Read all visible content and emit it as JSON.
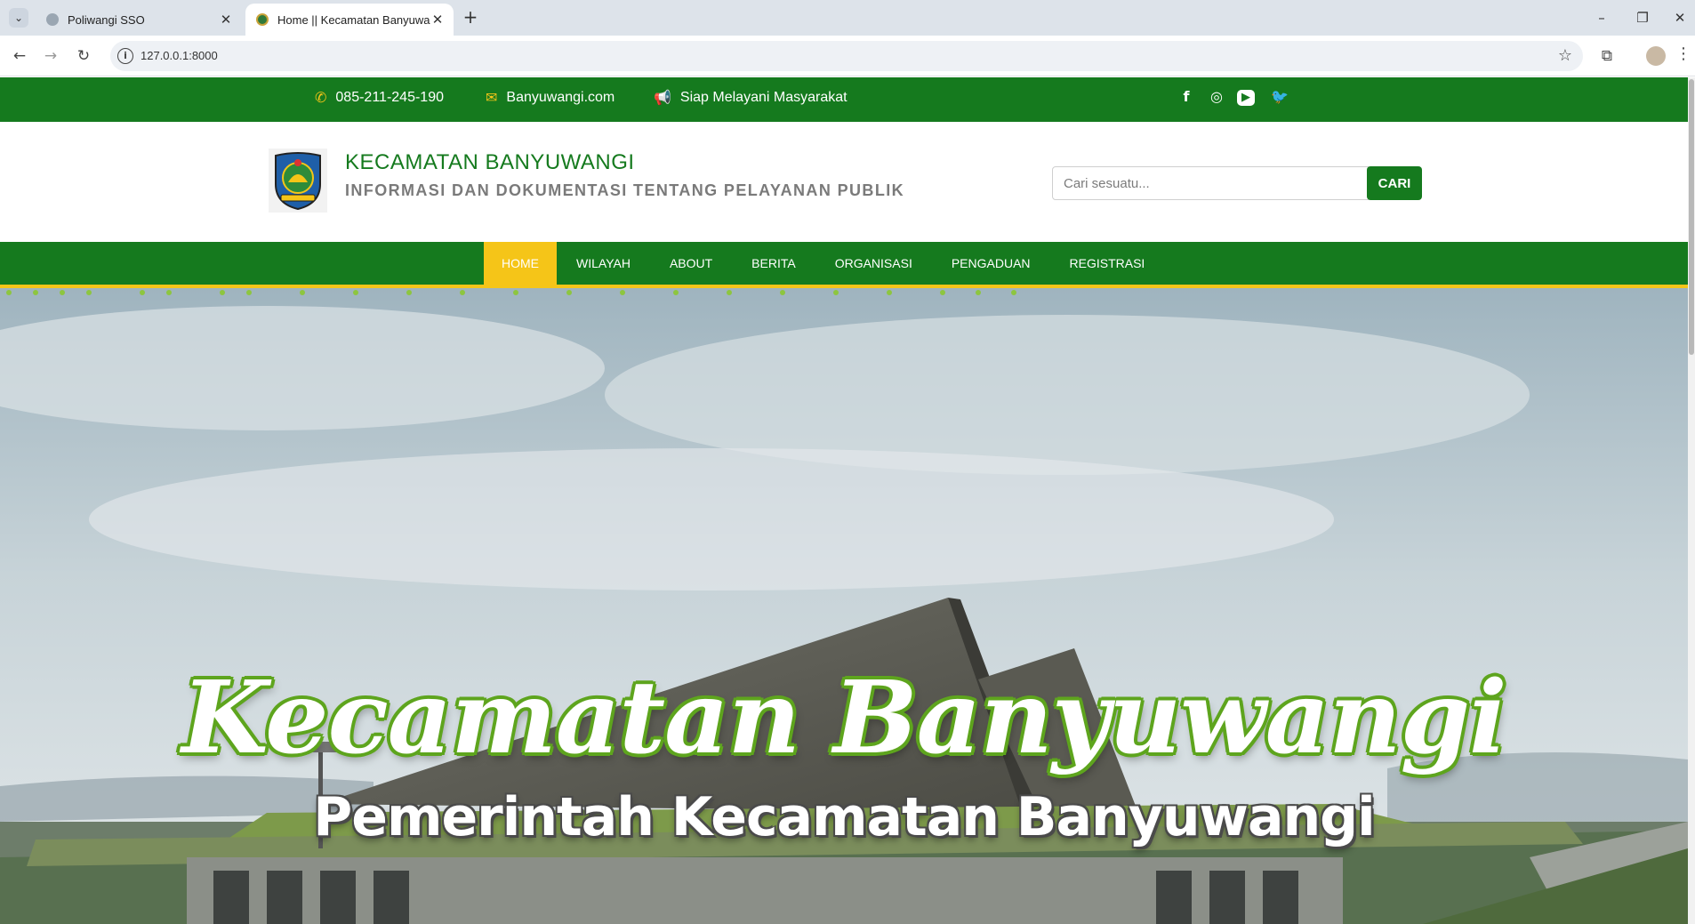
{
  "browser": {
    "tabs": [
      {
        "title": "Poliwangi SSO",
        "active": false
      },
      {
        "title": "Home || Kecamatan Banyuwangi",
        "active": true
      }
    ],
    "url": "127.0.0.1:8000",
    "window_controls": {
      "minimize": "–",
      "restore": "❐",
      "close": "✕"
    }
  },
  "topbar": {
    "phone": "085-211-245-190",
    "email": "Banyuwangi.com",
    "tagline": "Siap Melayani Masyarakat",
    "social": [
      "facebook-icon",
      "instagram-icon",
      "youtube-icon",
      "twitter-icon"
    ],
    "social_glyphs": {
      "facebook": "f",
      "instagram": "◎",
      "youtube": "▶",
      "twitter": "🐦"
    }
  },
  "header": {
    "title": "KECAMATAN BANYUWANGI",
    "subtitle": "INFORMASI DAN DOKUMENTASI TENTANG PELAYANAN PUBLIK",
    "search_placeholder": "Cari sesuatu...",
    "search_button": "CARI"
  },
  "nav": {
    "items": [
      {
        "label": "HOME",
        "active": true
      },
      {
        "label": "WILAYAH"
      },
      {
        "label": "ABOUT"
      },
      {
        "label": "BERITA"
      },
      {
        "label": "ORGANISASI"
      },
      {
        "label": "PENGADUAN"
      },
      {
        "label": "REGISTRASI"
      }
    ]
  },
  "hero": {
    "title": "Kecamatan Banyuwangi",
    "subtitle": "Pemerintah Kecamatan Banyuwangi"
  },
  "colors": {
    "brand_green": "#157a1e",
    "accent_yellow": "#f5c518",
    "subtitle_gray": "#7a7a7a"
  }
}
